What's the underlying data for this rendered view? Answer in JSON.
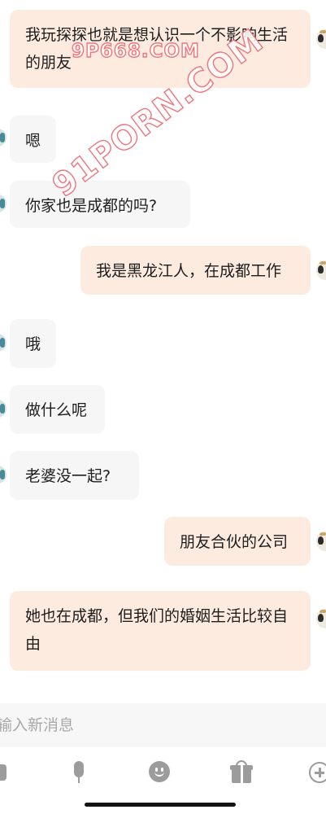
{
  "conversation": {
    "messages": [
      {
        "sender": "me",
        "text": "我玩探探也就是想认识一个不影响生活的朋友"
      },
      {
        "sender": "them",
        "text": "嗯"
      },
      {
        "sender": "them",
        "text": "你家也是成都的吗?"
      },
      {
        "sender": "me",
        "text": "我是黑龙江人，在成都工作"
      },
      {
        "sender": "them",
        "text": "哦"
      },
      {
        "sender": "them",
        "text": "做什么呢"
      },
      {
        "sender": "them",
        "text": "老婆没一起?"
      },
      {
        "sender": "me",
        "text": "朋友合伙的公司"
      },
      {
        "sender": "me",
        "text": "她也在成都，但我们的婚姻生活比较自由"
      }
    ]
  },
  "composer": {
    "placeholder": "输入新消息"
  },
  "toolbar": {
    "icons": [
      "keyboard-icon",
      "microphone-icon",
      "emoji-icon",
      "gift-icon",
      "plus-icon"
    ]
  },
  "watermarks": {
    "top": "9P668.COM",
    "diagonal": "91PORN.COM"
  },
  "colors": {
    "my_bubble": "#fdebdf",
    "their_bubble": "#f6f6f6",
    "icon_gray": "#9c9c9c",
    "watermark_stroke": "#f0747c"
  }
}
